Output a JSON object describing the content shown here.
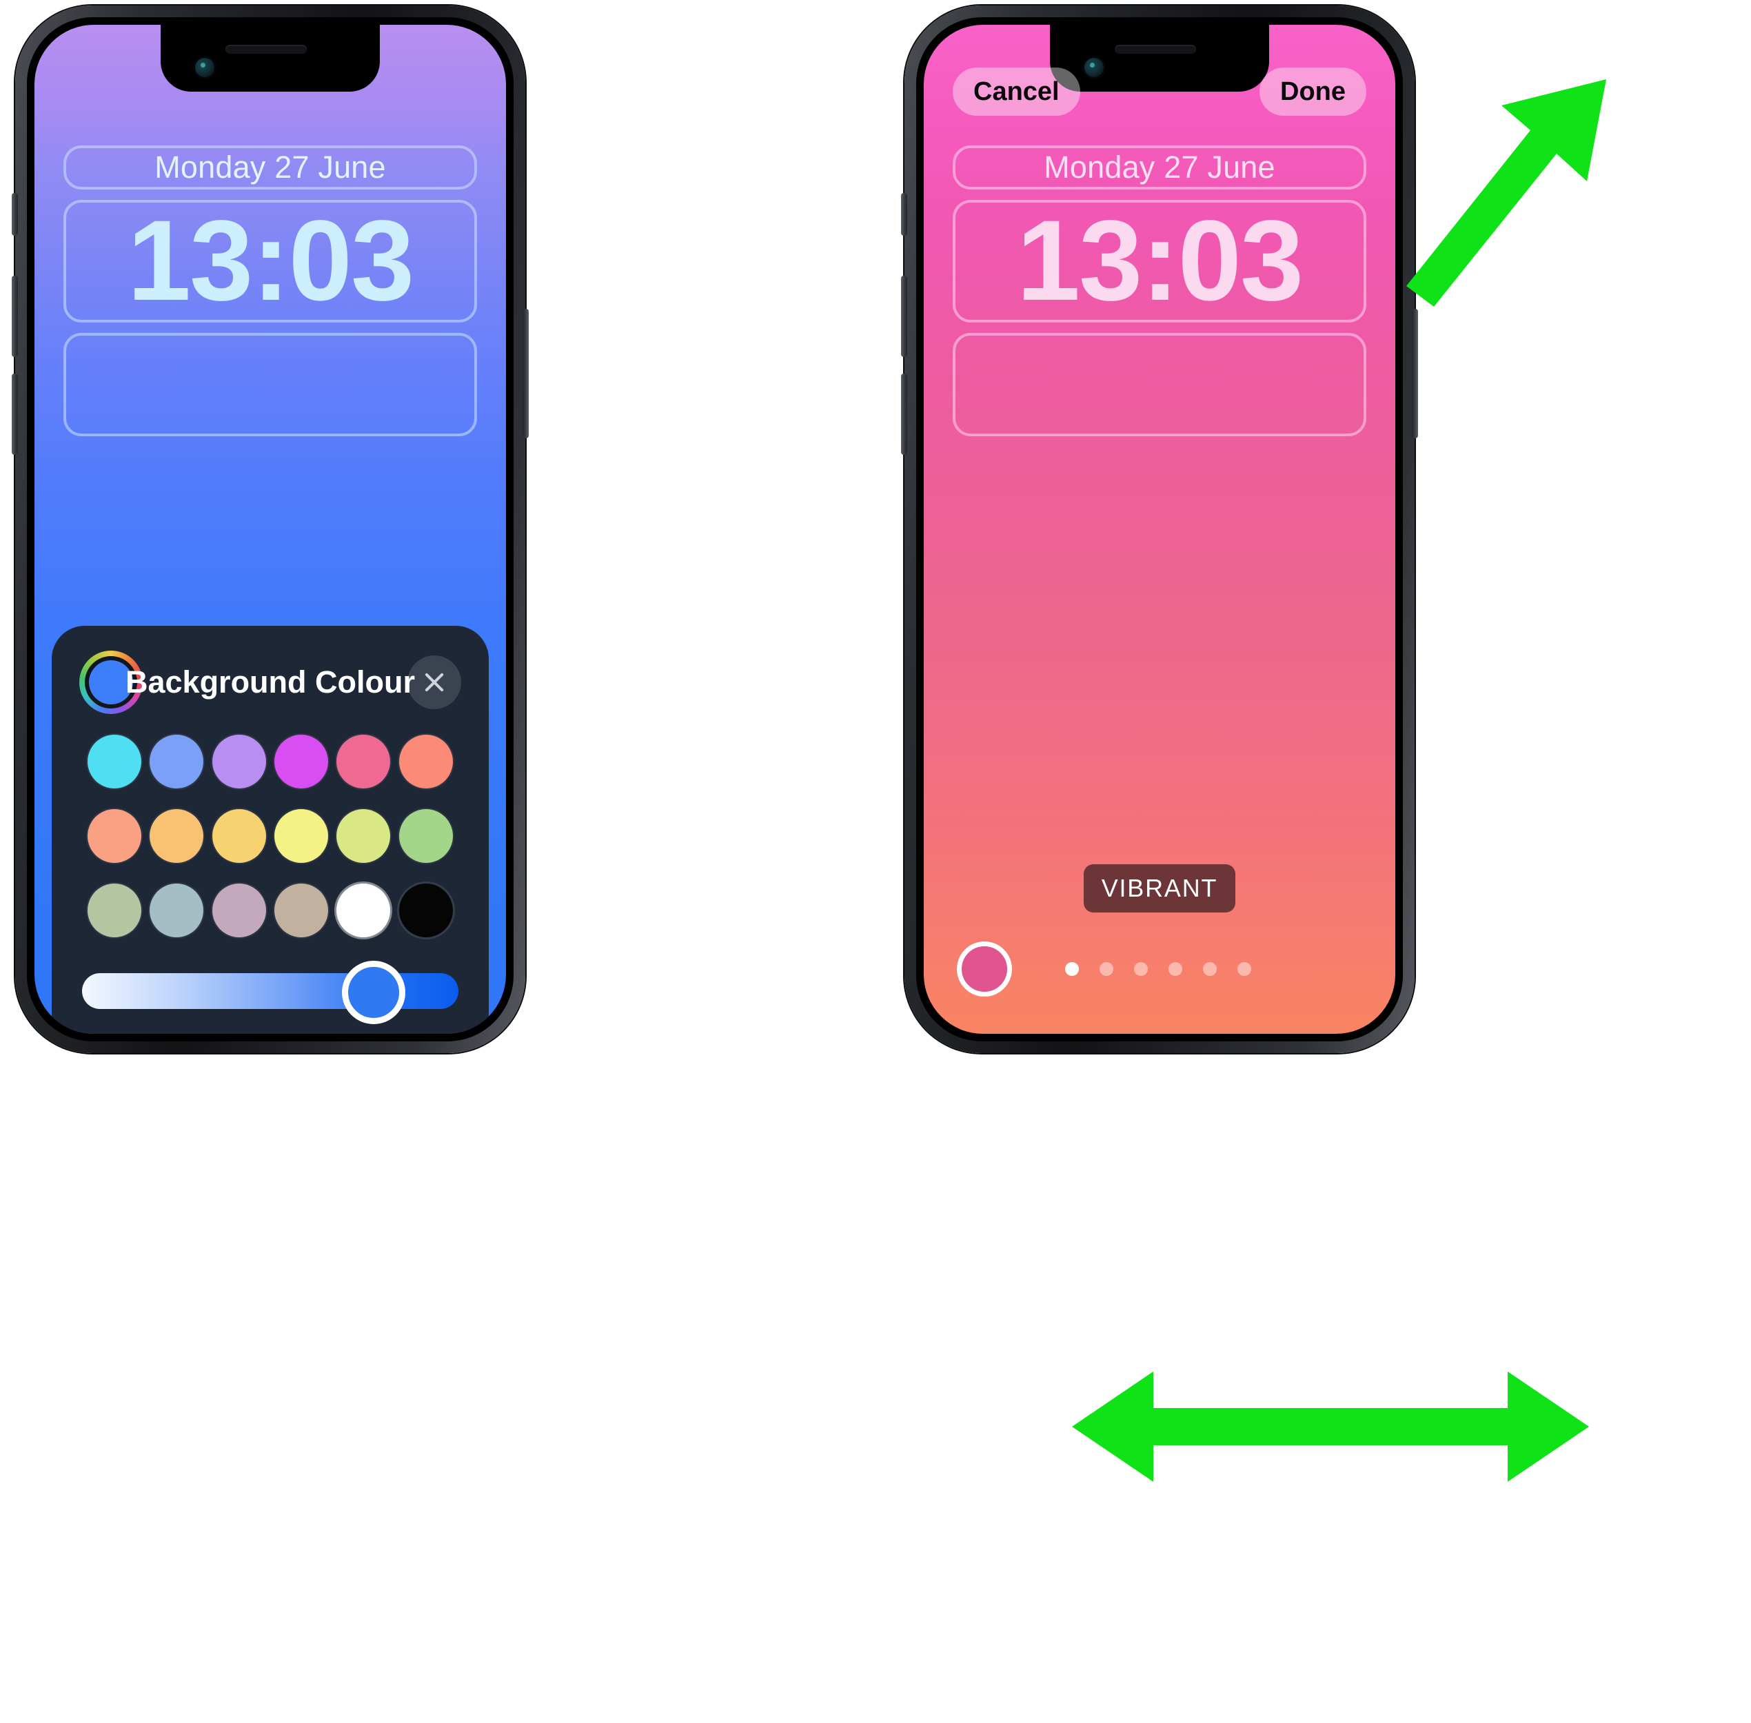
{
  "accent": {
    "green": "#10e218",
    "blue": "#3d7efb",
    "pink": "#e0558f"
  },
  "left_phone": {
    "name": "lock-screen-colour-picker",
    "wallpaper_style": "blue-gradient",
    "lock_screen": {
      "date": "Monday 27 June",
      "time": "13:03",
      "blank_widget_slot": ""
    },
    "colour_sheet": {
      "title": "Background Colour",
      "wheel_icon": "colour-wheel-icon",
      "close_icon": "close-x-icon",
      "swatches": [
        {
          "name": "cyan",
          "hex": "#4ee0f2"
        },
        {
          "name": "blue",
          "hex": "#7aa0f7"
        },
        {
          "name": "purple",
          "hex": "#b98ef2"
        },
        {
          "name": "magenta",
          "hex": "#d94ef2"
        },
        {
          "name": "pink",
          "hex": "#ef6a92"
        },
        {
          "name": "salmon",
          "hex": "#fb8a77"
        },
        {
          "name": "orange",
          "hex": "#fba183"
        },
        {
          "name": "light-orange",
          "hex": "#f9c172"
        },
        {
          "name": "amber",
          "hex": "#f7d271"
        },
        {
          "name": "pale-yellow",
          "hex": "#f5f285"
        },
        {
          "name": "yellow-green",
          "hex": "#d9e884"
        },
        {
          "name": "green",
          "hex": "#a3d689"
        },
        {
          "name": "sage",
          "hex": "#b5c5a2"
        },
        {
          "name": "blue-grey",
          "hex": "#a4bec6"
        },
        {
          "name": "mauve",
          "hex": "#c4a9bd"
        },
        {
          "name": "tan",
          "hex": "#c2b19f"
        },
        {
          "name": "white",
          "hex": "#ffffff"
        },
        {
          "name": "black",
          "hex": "#050505"
        }
      ],
      "brightness_slider": {
        "name": "brightness-slider",
        "value_percent": 77,
        "gradient_from": "#f4f8ff",
        "gradient_to": "#0a5cee",
        "thumb_colour": "#2f7af2"
      }
    }
  },
  "right_phone": {
    "name": "lock-screen-style-picker",
    "wallpaper_style": "pink-gradient",
    "topbar": {
      "cancel_label": "Cancel",
      "done_label": "Done"
    },
    "lock_screen": {
      "date": "Monday 27 June",
      "time": "13:03",
      "blank_widget_slot": ""
    },
    "style_picker": {
      "badge_label": "VIBRANT",
      "selected_colour": "#e0558f",
      "page_dots": {
        "total": 6,
        "active_index": 0
      }
    }
  },
  "annotations": [
    {
      "name": "arrow-to-done-button",
      "type": "diagonal-arrow",
      "colour": "#10e218",
      "points_to": "Done"
    },
    {
      "name": "swipe-horizontal-arrow",
      "type": "double-arrow",
      "colour": "#10e218",
      "points_to": "VIBRANT"
    }
  ]
}
